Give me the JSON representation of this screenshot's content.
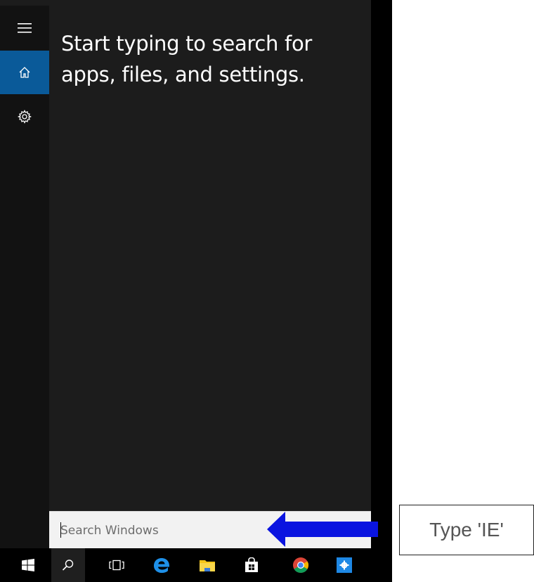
{
  "start_panel": {
    "hint_line1": "Start typing to search for",
    "hint_line2": "apps, files, and settings.",
    "rail": [
      {
        "name": "menu-icon"
      },
      {
        "name": "home-icon",
        "selected": true
      },
      {
        "name": "gear-icon"
      }
    ],
    "accent_color": "#0a5a99"
  },
  "search": {
    "placeholder": "Search Windows"
  },
  "taskbar": {
    "items": [
      {
        "name": "windows-logo-icon"
      },
      {
        "name": "search-icon"
      },
      {
        "name": "task-view-icon"
      },
      {
        "name": "edge-icon"
      },
      {
        "name": "file-explorer-icon"
      },
      {
        "name": "store-icon"
      },
      {
        "name": "chrome-icon"
      },
      {
        "name": "settings-app-icon"
      }
    ]
  },
  "annotation": {
    "callout_text": "Type 'IE'",
    "arrow_color": "#0a14e0"
  }
}
